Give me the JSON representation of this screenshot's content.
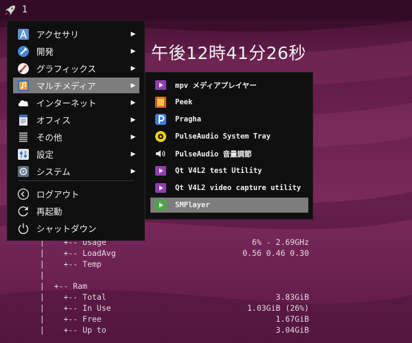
{
  "topbar": {
    "launcher_icon": "rocket-icon",
    "workspace_number": "1"
  },
  "clock": {
    "text": "午後12時41分26秒"
  },
  "main_menu": {
    "items": [
      {
        "label": "アクセサリ",
        "icon": "accessories-icon",
        "has_submenu": true
      },
      {
        "label": "開発",
        "icon": "development-icon",
        "has_submenu": true
      },
      {
        "label": "グラフィックス",
        "icon": "graphics-icon",
        "has_submenu": true
      },
      {
        "label": "マルチメディア",
        "icon": "multimedia-icon",
        "has_submenu": true,
        "active": true
      },
      {
        "label": "インターネット",
        "icon": "internet-icon",
        "has_submenu": true
      },
      {
        "label": "オフィス",
        "icon": "office-icon",
        "has_submenu": true
      },
      {
        "label": "その他",
        "icon": "other-icon",
        "has_submenu": true
      },
      {
        "label": "設定",
        "icon": "settings-icon",
        "has_submenu": true
      },
      {
        "label": "システム",
        "icon": "system-icon",
        "has_submenu": true
      }
    ],
    "session_items": [
      {
        "label": "ログアウト",
        "icon": "logout-icon"
      },
      {
        "label": "再起動",
        "icon": "reboot-icon"
      },
      {
        "label": "シャットダウン",
        "icon": "power-icon"
      }
    ],
    "arrow_glyph": "▶"
  },
  "submenu": {
    "items": [
      {
        "label": "mpv メディアプレイヤー",
        "icon": "play-purple-icon"
      },
      {
        "label": "Peek",
        "icon": "film-icon"
      },
      {
        "label": "Pragha",
        "icon": "pragha-icon"
      },
      {
        "label": "PulseAudio System Tray",
        "icon": "pulseaudio-icon"
      },
      {
        "label": "PulseAudio 音量調節",
        "icon": "speaker-icon"
      },
      {
        "label": "Qt V4L2 test Utility",
        "icon": "play-purple-icon"
      },
      {
        "label": "Qt V4L2 video capture utility",
        "icon": "play-purple-icon"
      },
      {
        "label": "SMPlayer",
        "icon": "smplayer-icon",
        "active": true
      }
    ]
  },
  "conky": {
    "rows": [
      {
        "text": "  |    +-- Usage",
        "value": "6% - 2.69GHz"
      },
      {
        "text": "  |    +-- LoadAvg",
        "value": "0.56 0.46 0.30"
      },
      {
        "text": "  |    +-- Temp",
        "value": ""
      },
      {
        "text": "  |",
        "value": ""
      },
      {
        "text": "  |  +-- Ram",
        "value": ""
      },
      {
        "text": "  |    +-- Total",
        "value": "3.83GiB"
      },
      {
        "text": "  |    +-- In Use",
        "value": "1.03GiB (26%)"
      },
      {
        "text": "  |    +-- Free",
        "value": "1.67GiB"
      },
      {
        "text": "  |    +-- Up to",
        "value": "3.04GiB"
      }
    ]
  },
  "colors": {
    "menu_bg": "#0f0f0f",
    "menu_highlight": "#7d7d7d",
    "text": "#f0f0f0",
    "wallpaper": "#6e2252"
  }
}
